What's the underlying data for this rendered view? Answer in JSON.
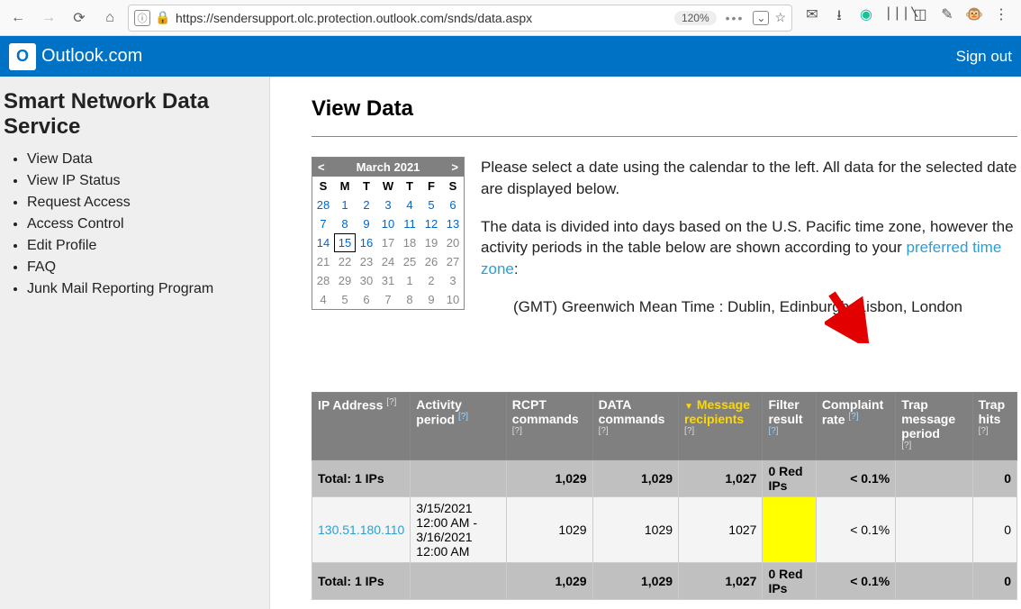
{
  "browser": {
    "url": "https://sendersupport.olc.protection.outlook.com/snds/data.aspx",
    "zoom": "120%"
  },
  "header": {
    "brand": "Outlook.com",
    "signout": "Sign out"
  },
  "sidebar": {
    "title": "Smart Network Data Service",
    "items": [
      "View Data",
      "View IP Status",
      "Request Access",
      "Access Control",
      "Edit Profile",
      "FAQ",
      "Junk Mail Reporting Program"
    ]
  },
  "main": {
    "title": "View Data",
    "desc1": "Please select a date using the calendar to the left. All data for the selected date are displayed below.",
    "desc2a": "The data is divided into days based on the U.S. Pacific time zone, however the activity periods in the table below are shown according to your ",
    "desc2link": "preferred time zone",
    "desc2b": ":",
    "tz": "(GMT) Greenwich Mean Time : Dublin, Edinburgh, Lisbon, London"
  },
  "calendar": {
    "prev": "<",
    "month": "March 2021",
    "next": ">",
    "dow": [
      "S",
      "M",
      "T",
      "W",
      "T",
      "F",
      "S"
    ],
    "rows": [
      [
        {
          "n": "28",
          "t": "link"
        },
        {
          "n": "1",
          "t": "link"
        },
        {
          "n": "2",
          "t": "link"
        },
        {
          "n": "3",
          "t": "link"
        },
        {
          "n": "4",
          "t": "link"
        },
        {
          "n": "5",
          "t": "link"
        },
        {
          "n": "6",
          "t": "link"
        }
      ],
      [
        {
          "n": "7",
          "t": "link"
        },
        {
          "n": "8",
          "t": "link"
        },
        {
          "n": "9",
          "t": "link"
        },
        {
          "n": "10",
          "t": "link"
        },
        {
          "n": "11",
          "t": "link"
        },
        {
          "n": "12",
          "t": "link"
        },
        {
          "n": "13",
          "t": "link"
        }
      ],
      [
        {
          "n": "14",
          "t": "link"
        },
        {
          "n": "15",
          "t": "today"
        },
        {
          "n": "16",
          "t": "link"
        },
        {
          "n": "17",
          "t": "gray"
        },
        {
          "n": "18",
          "t": "gray"
        },
        {
          "n": "19",
          "t": "gray"
        },
        {
          "n": "20",
          "t": "gray"
        }
      ],
      [
        {
          "n": "21",
          "t": "gray"
        },
        {
          "n": "22",
          "t": "gray"
        },
        {
          "n": "23",
          "t": "gray"
        },
        {
          "n": "24",
          "t": "gray"
        },
        {
          "n": "25",
          "t": "gray"
        },
        {
          "n": "26",
          "t": "gray"
        },
        {
          "n": "27",
          "t": "gray"
        }
      ],
      [
        {
          "n": "28",
          "t": "gray"
        },
        {
          "n": "29",
          "t": "gray"
        },
        {
          "n": "30",
          "t": "gray"
        },
        {
          "n": "31",
          "t": "gray"
        },
        {
          "n": "1",
          "t": "gray"
        },
        {
          "n": "2",
          "t": "gray"
        },
        {
          "n": "3",
          "t": "gray"
        }
      ],
      [
        {
          "n": "4",
          "t": "gray"
        },
        {
          "n": "5",
          "t": "gray"
        },
        {
          "n": "6",
          "t": "gray"
        },
        {
          "n": "7",
          "t": "gray"
        },
        {
          "n": "8",
          "t": "gray"
        },
        {
          "n": "9",
          "t": "gray"
        },
        {
          "n": "10",
          "t": "gray"
        }
      ]
    ]
  },
  "table": {
    "headers": {
      "ip": "IP Address",
      "activity": "Activity period",
      "rcpt": "RCPT commands",
      "data": "DATA commands",
      "msg_sort": "▼",
      "msg": "Message recipients",
      "filter": "Filter result",
      "complaint": "Complaint rate",
      "trap_period": "Trap message period",
      "trap_hits": "Trap hits",
      "help": "[?]"
    },
    "totals_label": "Total: 1 IPs",
    "totals": {
      "rcpt": "1,029",
      "data": "1,029",
      "msg": "1,027",
      "filter": "0 Red IPs",
      "complaint": "< 0.1%",
      "trap_hits": "0"
    },
    "row": {
      "ip": "130.51.180.110",
      "activity": "3/15/2021 12:00 AM - 3/16/2021 12:00 AM",
      "rcpt": "1029",
      "data": "1029",
      "msg": "1027",
      "filter": "",
      "complaint": "< 0.1%",
      "trap_period": "",
      "trap_hits": "0"
    }
  }
}
